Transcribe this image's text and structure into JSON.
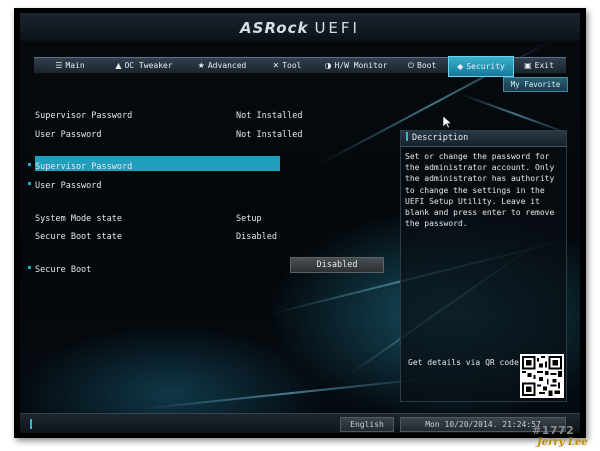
{
  "header": {
    "brand": "ASRock",
    "product": "UEFI"
  },
  "tabs": [
    {
      "icon": "list-icon",
      "glyph": "☰",
      "label": "Main"
    },
    {
      "icon": "rocket-icon",
      "glyph": "▲",
      "label": "OC Tweaker"
    },
    {
      "icon": "star-icon",
      "glyph": "★",
      "label": "Advanced"
    },
    {
      "icon": "tool-icon",
      "glyph": "✕",
      "label": "Tool"
    },
    {
      "icon": "monitor-icon",
      "glyph": "◑",
      "label": "H/W Monitor"
    },
    {
      "icon": "power-icon",
      "glyph": "⏻",
      "label": "Boot"
    },
    {
      "icon": "shield-icon",
      "glyph": "◆",
      "label": "Security",
      "active": true
    },
    {
      "icon": "exit-icon",
      "glyph": "▣",
      "label": "Exit"
    }
  ],
  "my_favorite": "My Favorite",
  "info": [
    {
      "label": "Supervisor Password",
      "value": "Not Installed"
    },
    {
      "label": "User Password",
      "value": "Not Installed"
    }
  ],
  "menu": [
    {
      "label": "Supervisor Password",
      "selected": true
    },
    {
      "label": "User Password",
      "selected": false
    }
  ],
  "states": [
    {
      "label": "System Mode state",
      "value": "Setup"
    },
    {
      "label": "Secure Boot state",
      "value": "Disabled"
    }
  ],
  "secure_boot": {
    "label": "Secure Boot",
    "value": "Disabled"
  },
  "description": {
    "title": "Description",
    "text": "Set or change the password for the administrator account. Only the administrator has authority to change the settings in the UEFI Setup Utility. Leave it blank and press enter to remove the password.",
    "qr_label": "Get details via QR code"
  },
  "status": {
    "language": "English",
    "datetime": "Mon 10/20/2014. 21:24:57"
  },
  "watermark": "#1772",
  "signature": "Jerry Lee",
  "colors": {
    "accent": "#1f9fbb",
    "background": "#03070b",
    "text": "#e5e9ec"
  }
}
